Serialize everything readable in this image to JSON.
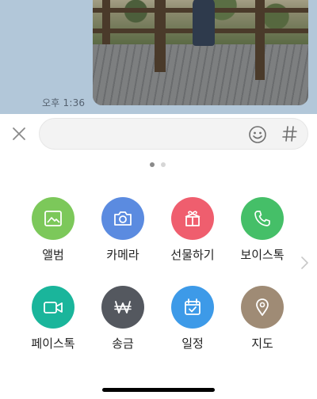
{
  "message": {
    "time": "오후 1:36"
  },
  "input": {
    "placeholder": ""
  },
  "pager": {
    "current": 1,
    "total": 2
  },
  "menu": {
    "items": [
      {
        "label": "앨범",
        "icon": "album-icon",
        "color": "#7cc85a"
      },
      {
        "label": "카메라",
        "icon": "camera-icon",
        "color": "#5b8be0"
      },
      {
        "label": "선물하기",
        "icon": "gift-icon",
        "color": "#ef5e6e"
      },
      {
        "label": "보이스톡",
        "icon": "phone-icon",
        "color": "#45bf68"
      },
      {
        "label": "페이스톡",
        "icon": "video-icon",
        "color": "#1ab59b"
      },
      {
        "label": "송금",
        "icon": "won-icon",
        "color": "#54585f"
      },
      {
        "label": "일정",
        "icon": "calendar-icon",
        "color": "#3d9ae8"
      },
      {
        "label": "지도",
        "icon": "map-pin-icon",
        "color": "#9f8b75"
      }
    ]
  }
}
